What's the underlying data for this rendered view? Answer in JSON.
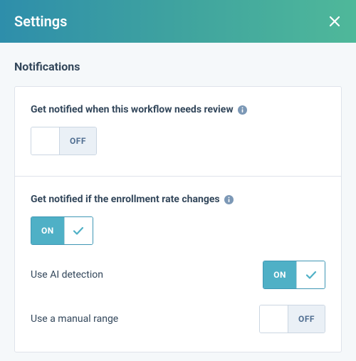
{
  "header": {
    "title": "Settings"
  },
  "section": {
    "title": "Notifications"
  },
  "labels": {
    "on": "ON",
    "off": "OFF"
  },
  "settings": {
    "review": {
      "label": "Get notified when this workflow needs review",
      "state": "off"
    },
    "enrollment": {
      "label": "Get notified if the enrollment rate changes",
      "state": "on",
      "aiDetection": {
        "label": "Use AI detection",
        "state": "on"
      },
      "manualRange": {
        "label": "Use a manual range",
        "state": "off"
      }
    }
  }
}
